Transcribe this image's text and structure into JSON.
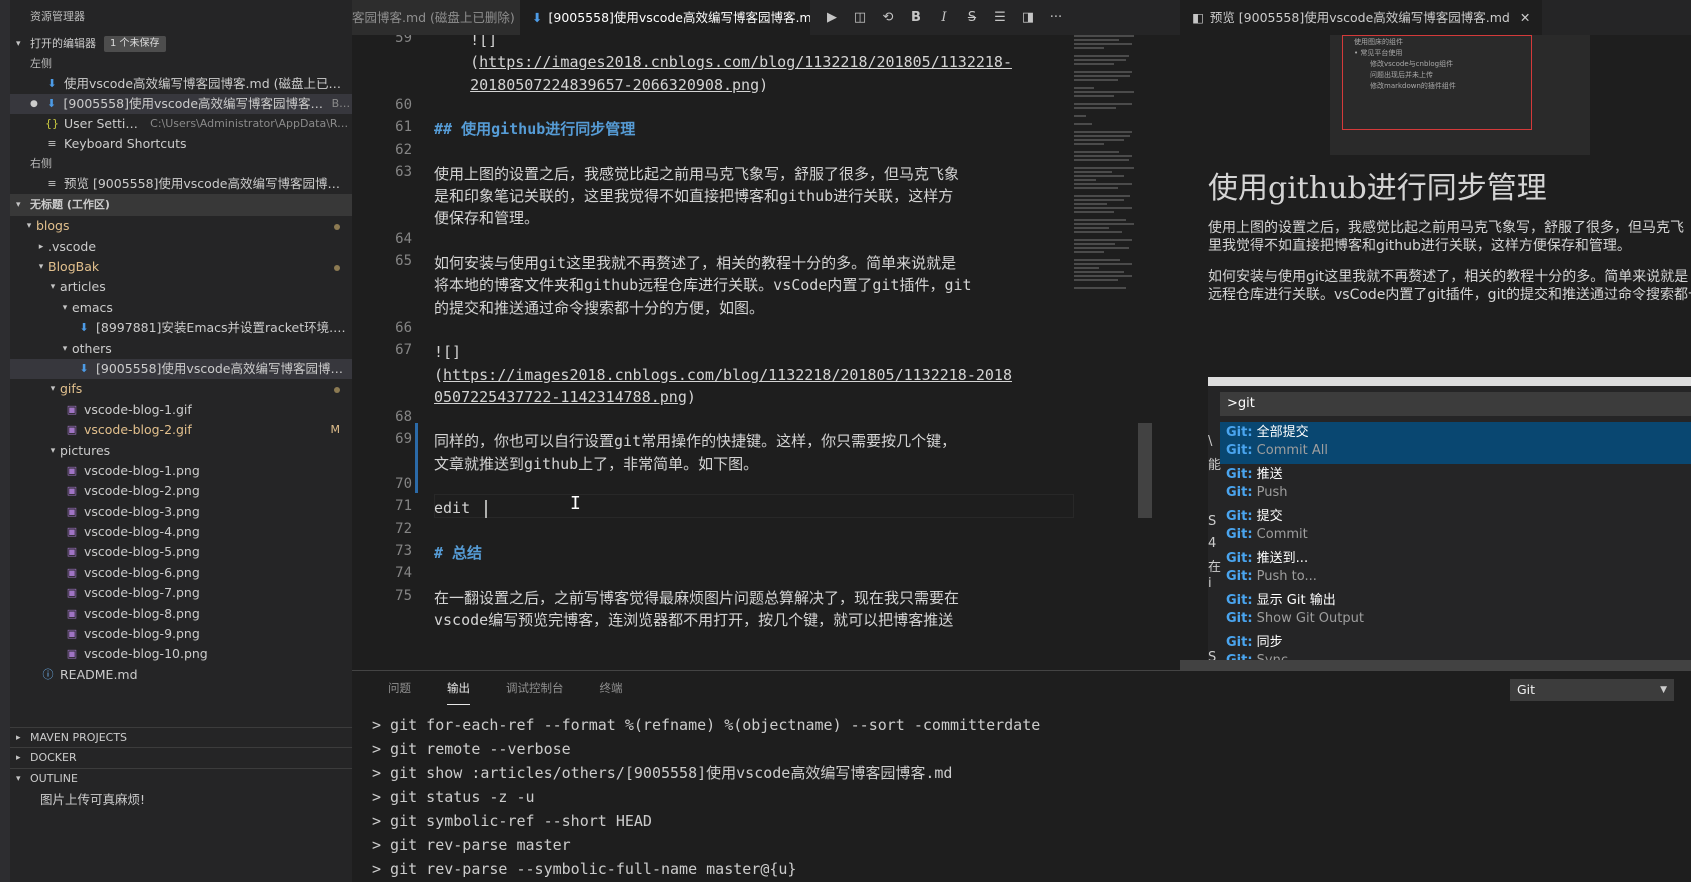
{
  "sidebar": {
    "title": "资源管理器",
    "open_editors": {
      "header": "打开的编辑器",
      "badge": "1 个未保存",
      "groups": [
        {
          "label": "左侧"
        },
        {
          "label": "右侧"
        }
      ],
      "items": [
        {
          "icon": "markdown-icon",
          "label": "使用vscode高效编写博客园博客.md (磁盘上已删...",
          "detail": ""
        },
        {
          "icon": "markdown-icon",
          "label": "[9005558]使用vscode高效编写博客园博客.md",
          "detail": "Bl..."
        },
        {
          "icon": "json-icon",
          "label": "User Settings",
          "detail": "C:\\Users\\Administrator\\AppData\\Roa..."
        },
        {
          "icon": "keyboard-icon",
          "label": "Keyboard Shortcuts",
          "detail": ""
        },
        {
          "icon": "preview-icon",
          "label": "预览 [9005558]使用vscode高效编写博客园博客....",
          "detail": ""
        }
      ]
    },
    "workspace": {
      "header": "无标题 (工作区)",
      "tree": [
        {
          "label": "blogs",
          "twisty": "▾",
          "indent": 0,
          "color": "yellow",
          "dot": true
        },
        {
          "label": ".vscode",
          "twisty": "▸",
          "indent": 1
        },
        {
          "label": "BlogBak",
          "twisty": "▾",
          "indent": 1,
          "color": "yellow",
          "dot": true
        },
        {
          "label": "articles",
          "twisty": "▾",
          "indent": 2
        },
        {
          "label": "emacs",
          "twisty": "▾",
          "indent": 3
        },
        {
          "label": "[8997881]安装Emacs并设置racket环境.md",
          "indent": 4,
          "icon": "md"
        },
        {
          "label": "others",
          "twisty": "▾",
          "indent": 3
        },
        {
          "label": "[9005558]使用vscode高效编写博客园博客.m...",
          "indent": 4,
          "icon": "md",
          "selected": true
        },
        {
          "label": "gifs",
          "twisty": "▾",
          "indent": 2,
          "color": "yellow",
          "dot": true
        },
        {
          "label": "vscode-blog-1.gif",
          "indent": 3,
          "icon": "img"
        },
        {
          "label": "vscode-blog-2.gif",
          "indent": 3,
          "icon": "img",
          "color": "yellow",
          "mod": "M"
        },
        {
          "label": "pictures",
          "twisty": "▾",
          "indent": 2
        },
        {
          "label": "vscode-blog-1.png",
          "indent": 3,
          "icon": "img"
        },
        {
          "label": "vscode-blog-2.png",
          "indent": 3,
          "icon": "img"
        },
        {
          "label": "vscode-blog-3.png",
          "indent": 3,
          "icon": "img"
        },
        {
          "label": "vscode-blog-4.png",
          "indent": 3,
          "icon": "img"
        },
        {
          "label": "vscode-blog-5.png",
          "indent": 3,
          "icon": "img"
        },
        {
          "label": "vscode-blog-6.png",
          "indent": 3,
          "icon": "img"
        },
        {
          "label": "vscode-blog-7.png",
          "indent": 3,
          "icon": "img"
        },
        {
          "label": "vscode-blog-8.png",
          "indent": 3,
          "icon": "img"
        },
        {
          "label": "vscode-blog-9.png",
          "indent": 3,
          "icon": "img"
        },
        {
          "label": "vscode-blog-10.png",
          "indent": 3,
          "icon": "img"
        },
        {
          "label": "README.md",
          "indent": 1,
          "icon": "info"
        }
      ]
    },
    "bottom_sections": [
      "MAVEN PROJECTS",
      "DOCKER",
      "OUTLINE"
    ],
    "outline_item": "图片上传可真麻烦!"
  },
  "tabs": {
    "left_partial": "客园博客.md (磁盘上已删除)",
    "active": "[9005558]使用vscode高效编写博客园博客.md",
    "preview": "预览 [9005558]使用vscode高效编写博客园博客.md",
    "close_glyph": "✕"
  },
  "toolbar_icons": [
    "run-icon",
    "split-preview-icon",
    "sync-icon",
    "bold-icon",
    "italic-icon",
    "strikethrough-icon",
    "list-icon",
    "split-editor-icon",
    "more-icon"
  ],
  "editor": {
    "lines": [
      {
        "n": "59",
        "segments": [
          {
            "t": "    ![]"
          }
        ]
      },
      {
        "n": "",
        "segments": [
          {
            "t": "    ("
          },
          {
            "t": "https://images2018.cnblogs.com/blog/1132218/201805/1132218-",
            "link": true
          }
        ]
      },
      {
        "n": "",
        "segments": [
          {
            "t": "    "
          },
          {
            "t": "20180507224839657-2066320908.png",
            "link": true
          },
          {
            "t": ")"
          }
        ]
      },
      {
        "n": "60",
        "segments": []
      },
      {
        "n": "61",
        "segments": [
          {
            "t": "## 使用github进行同步管理",
            "heading": true
          }
        ]
      },
      {
        "n": "62",
        "segments": []
      },
      {
        "n": "63",
        "segments": [
          {
            "t": "使用上图的设置之后，我感觉比起之前用马克飞象写，舒服了很多，但马克飞象"
          }
        ]
      },
      {
        "n": "",
        "segments": [
          {
            "t": "是和印象笔记关联的，这里我觉得不如直接把博客和github进行关联，这样方"
          }
        ]
      },
      {
        "n": "",
        "segments": [
          {
            "t": "便保存和管理。"
          }
        ]
      },
      {
        "n": "64",
        "segments": []
      },
      {
        "n": "65",
        "segments": [
          {
            "t": "如何安装与使用git这里我就不再赘述了，相关的教程十分的多。简单来说就是"
          }
        ]
      },
      {
        "n": "",
        "segments": [
          {
            "t": "将本地的博客文件夹和github远程仓库进行关联。vsCode内置了git插件，git"
          }
        ]
      },
      {
        "n": "",
        "segments": [
          {
            "t": "的提交和推送通过命令搜索都十分的方便，如图。"
          }
        ]
      },
      {
        "n": "66",
        "segments": []
      },
      {
        "n": "67",
        "segments": [
          {
            "t": "![]"
          }
        ]
      },
      {
        "n": "",
        "segments": [
          {
            "t": "("
          },
          {
            "t": "https://images2018.cnblogs.com/blog/1132218/201805/1132218-2018",
            "link": true
          }
        ]
      },
      {
        "n": "",
        "segments": [
          {
            "t": "0507225437722-1142314788.png",
            "link": true
          },
          {
            "t": ")"
          }
        ]
      },
      {
        "n": "68",
        "segments": []
      },
      {
        "n": "69",
        "segments": [
          {
            "t": "同样的，你也可以自行设置git常用操作的快捷键。这样，你只需要按几个键，"
          }
        ]
      },
      {
        "n": "",
        "segments": [
          {
            "t": "文章就推送到github上了，非常简单。如下图。"
          }
        ]
      },
      {
        "n": "70",
        "segments": []
      },
      {
        "n": "71",
        "segments": [
          {
            "t": "edit "
          }
        ],
        "cursor": true
      },
      {
        "n": "72",
        "segments": []
      },
      {
        "n": "73",
        "segments": [
          {
            "t": "# 总结",
            "heading": true
          }
        ]
      },
      {
        "n": "74",
        "segments": []
      },
      {
        "n": "75",
        "segments": [
          {
            "t": "在一翻设置之后，之前写博客觉得最麻烦图片问题总算解决了，现在我只需要在"
          }
        ]
      },
      {
        "n": "",
        "segments": [
          {
            "t": "vscode编写预览完博客，连浏览器都不用打开，按几个键，就可以把博客推送"
          }
        ]
      }
    ]
  },
  "preview": {
    "thumb_lines": [
      "使用图床的组件",
      "• 常见平台使用",
      "   修改vscode与cnblog组件",
      "   问题出现后并未上传",
      "   修改markdown的插件组件"
    ],
    "heading": "使用github进行同步管理",
    "para1_l1": "使用上图的设置之后，我感觉比起之前用马克飞象写，舒服了很多，但马克飞",
    "para1_l2": "里我觉得不如直接把博客和github进行关联，这样方便保存和管理。",
    "para2_l1": "如何安装与使用git这里我就不再赘述了，相关的教程十分的多。简单来说就是",
    "para2_l2": "远程仓库进行关联。vsCode内置了git插件，git的提交和推送通过命令搜索都十",
    "palette_input": ">git",
    "palette_items": [
      {
        "prefix": "Git:",
        "a": " 全部提交",
        "b": " Commit All",
        "selected": true
      },
      {
        "prefix": "Git:",
        "a": " 推送",
        "b": " Push"
      },
      {
        "prefix": "Git:",
        "a": " 提交",
        "b": " Commit"
      },
      {
        "prefix": "Git:",
        "a": " 推送到...",
        "b": " Push to..."
      },
      {
        "prefix": "Git:",
        "a": " 显示 Git 输出",
        "b": " Show Git Output"
      },
      {
        "prefix": "Git:",
        "a": " 同步",
        "b": " Sync"
      }
    ],
    "edge_chars": [
      "\\",
      "能",
      "S",
      "4",
      "在",
      "i",
      "S"
    ]
  },
  "panel": {
    "tabs": [
      "问题",
      "输出",
      "调试控制台",
      "终端"
    ],
    "active_tab": 1,
    "select_value": "Git",
    "output": [
      "> git for-each-ref --format %(refname) %(objectname) --sort -committerdate",
      "> git remote --verbose",
      "> git show :articles/others/[9005558]使用vscode高效编写博客园博客.md",
      "> git status -z -u",
      "> git symbolic-ref --short HEAD",
      "> git rev-parse master",
      "> git rev-parse --symbolic-full-name master@{u}"
    ]
  }
}
